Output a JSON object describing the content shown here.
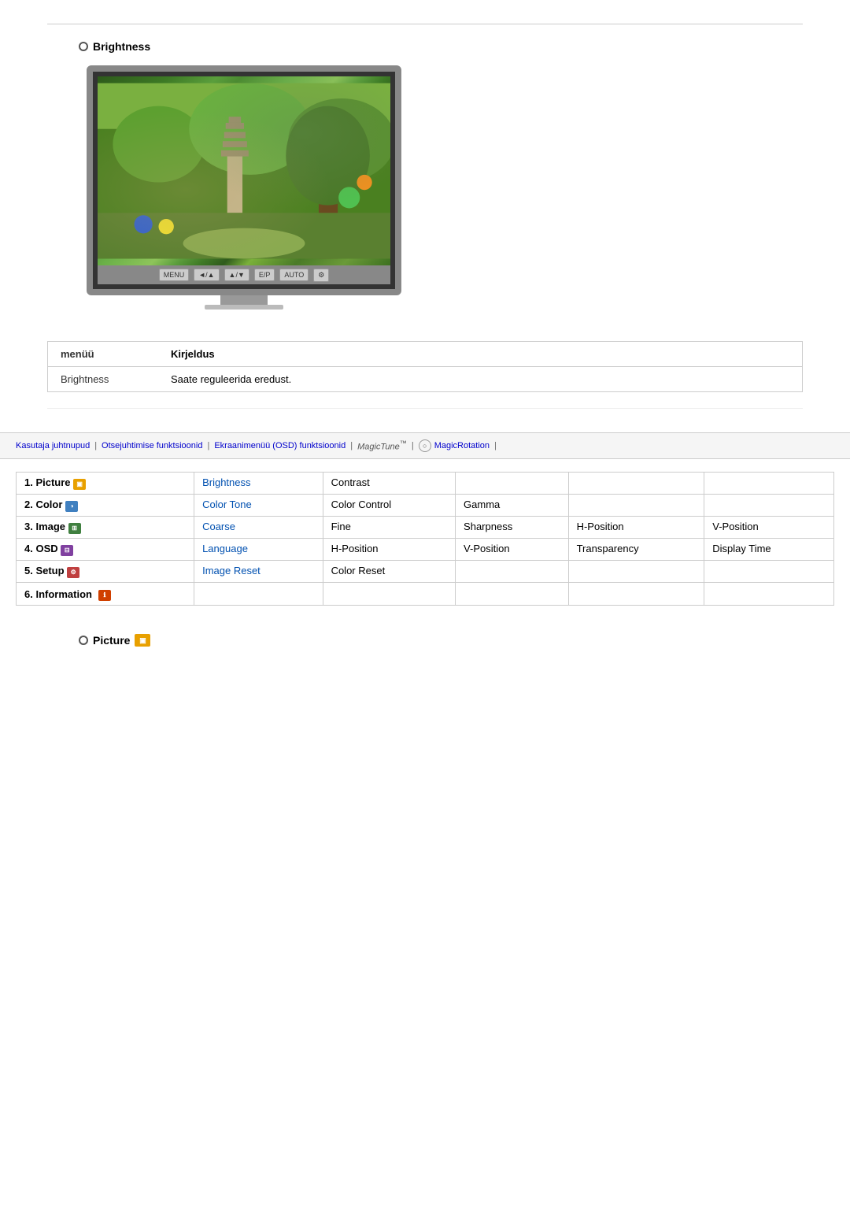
{
  "top": {
    "brightness_heading": "Brightness",
    "radio_label": "○"
  },
  "monitor": {
    "buttons": [
      "MENU",
      "◄/▲",
      "▲/▼",
      "E/P",
      "AUTO",
      "⚙"
    ]
  },
  "menu_table": {
    "col_menu": "menüü",
    "col_description": "Kirjeldus",
    "row1_menu": "Brightness",
    "row1_desc": "Saate reguleerida eredust."
  },
  "navbar": {
    "item1": "Kasutaja juhtnupud",
    "item2": "Otsejuhtimise funktsioonid",
    "item3": "Ekraanimenüü (OSD) funktsioonid",
    "item4": "MagicTune™",
    "item5": "MagicRotation"
  },
  "osd_table": {
    "rows": [
      {
        "label": "1. Picture",
        "icon_type": "orange",
        "cells": [
          "Brightness",
          "Contrast",
          "",
          "",
          ""
        ]
      },
      {
        "label": "2. Color",
        "icon_type": "blue",
        "cells": [
          "Color Tone",
          "Color Control",
          "Gamma",
          "",
          ""
        ]
      },
      {
        "label": "3. Image",
        "icon_type": "green",
        "cells": [
          "Coarse",
          "Fine",
          "Sharpness",
          "H-Position",
          "V-Position"
        ]
      },
      {
        "label": "4. OSD",
        "icon_type": "purple",
        "cells": [
          "Language",
          "H-Position",
          "V-Position",
          "Transparency",
          "Display Time"
        ]
      },
      {
        "label": "5. Setup",
        "icon_type": "red",
        "cells": [
          "Image Reset",
          "Color Reset",
          "",
          "",
          ""
        ]
      },
      {
        "label": "6. Information",
        "icon_type": "info",
        "cells": [
          "",
          "",
          "",
          "",
          ""
        ]
      }
    ]
  },
  "picture_label": "Picture"
}
